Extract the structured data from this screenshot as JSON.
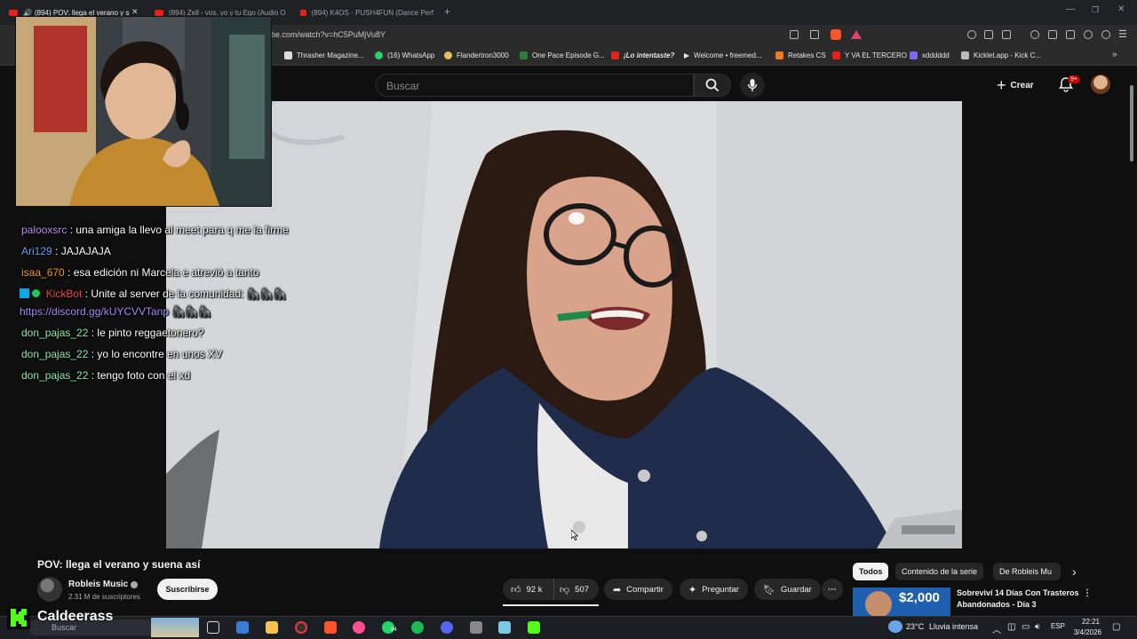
{
  "browser": {
    "tabs": [
      {
        "title": "(894) POV: llega el verano y s"
      },
      {
        "title": "(894) Zell - vos, yo y tu Ego (Audio O"
      },
      {
        "title": "(894) K4OS - PUSH4FUN (Dance Perf"
      }
    ],
    "url": "be.com/watch?v=hC5PuMjVu8Y",
    "bookmarks": [
      {
        "label": "Thrasher Magazine...",
        "color": "#d9d9d9"
      },
      {
        "label": "(16) WhatsApp",
        "color": "#25d366"
      },
      {
        "label": "Flandertron3000",
        "color": "#e0c060"
      },
      {
        "label": "One Pace Episode G...",
        "color": "#2e7d32"
      },
      {
        "label": "¡Lo intentaste?",
        "color": "#e62117"
      },
      {
        "label": "Welcome • freemed...",
        "color": "#ffffff"
      },
      {
        "label": "Retakes CS",
        "color": "#f07b22"
      },
      {
        "label": "Y VA EL TERCERO",
        "color": "#e62117"
      },
      {
        "label": "xdddddd",
        "color": "#7b68ee"
      },
      {
        "label": "Kicklet.app - Kick C...",
        "color": "#bbbbbb"
      }
    ]
  },
  "masthead": {
    "search_placeholder": "Buscar",
    "create_label": "Crear",
    "notification_count": "9+"
  },
  "chat": [
    {
      "user": "palooxsrc",
      "message": "una amiga la llevo al meet para q me la firme",
      "color": "#c084fc"
    },
    {
      "user": "Ari129",
      "message": "JAJAJAJA",
      "color": "#60a5fa"
    },
    {
      "user": "isaa_670",
      "message": "esa edición ni Marcela e atrevió a tanto",
      "color": "#f59e0b"
    },
    {
      "user": "KickBot",
      "message": "Unite al server de la comunidad: 🦍🦍🦍",
      "color": "#ef4444",
      "link": "https://discord.gg/kUYCVVTanp",
      "link_suffix": "🦍🦍🦍"
    },
    {
      "user": "don_pajas_22",
      "message": "le pinto reggaetonero?",
      "color": "#86efac"
    },
    {
      "user": "don_pajas_22",
      "message": "yo lo encontre en unos XV",
      "color": "#86efac"
    },
    {
      "user": "don_pajas_22",
      "message": "tengo foto con el xd",
      "color": "#86efac"
    }
  ],
  "video": {
    "title": "POV: llega el verano y suena así",
    "channel": "Robleis Music",
    "subscribers": "2.31 M de suscriptores",
    "subscribe_label": "Suscribirse",
    "likes": "92 k",
    "dislikes": "507",
    "share_label": "Compartir",
    "ask_label": "Preguntar",
    "save_label": "Guardar"
  },
  "related": {
    "chips": [
      "Todos",
      "Contenido de la serie",
      "De Robleis Mu"
    ],
    "first_item": {
      "thumb_text": "$2,000",
      "title_line1": "Sobreviví 14 Días Con Trasteros",
      "title_line2": "Abandonados - Día 3"
    }
  },
  "streamer": {
    "name": "Caldeerass"
  },
  "taskbar": {
    "search": "Buscar",
    "temperature": "23°C",
    "weather": "Lluvia intensa",
    "language": "ESP",
    "time": "22:21",
    "date": "3/4/2026",
    "whatsapp_badge": "94"
  }
}
